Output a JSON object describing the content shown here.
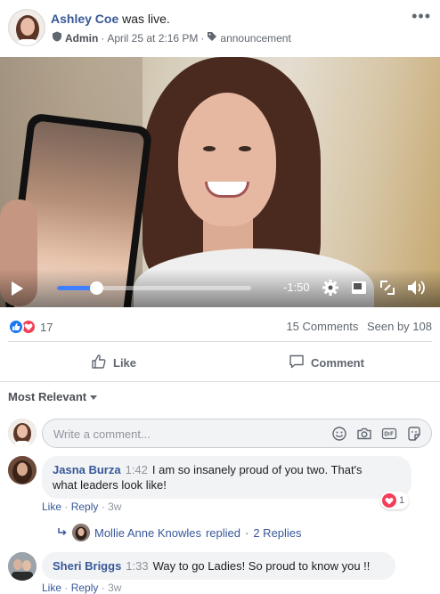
{
  "post": {
    "author": "Ashley Coe",
    "verb": "was live.",
    "role": "Admin",
    "date": "April 25 at 2:16 PM",
    "separator": "·",
    "tag": "announcement",
    "more": "•••"
  },
  "video": {
    "time_remaining": "-1:50",
    "progress": 0.2
  },
  "stats": {
    "reaction_count": "17",
    "comments": "15 Comments",
    "seen": "Seen by 108"
  },
  "actions": {
    "like_label": "Like",
    "comment_label": "Comment"
  },
  "sort": {
    "label": "Most Relevant"
  },
  "composer": {
    "placeholder": "Write a comment..."
  },
  "comments": [
    {
      "name": "Jasna Burza",
      "time": "1:42",
      "text": "I am so insanely proud of you two. That's",
      "text2": "what leaders look like!",
      "like": "Like",
      "reply": "Reply",
      "age": "3w",
      "reaction_count": "1",
      "replies": {
        "name": "Mollie Anne Knowles",
        "action": "replied",
        "count": "2 Replies"
      }
    },
    {
      "name": "Sheri Briggs",
      "time": "1:33",
      "text": "Way to go Ladies! So proud to know you !!",
      "like": "Like",
      "reply": "Reply",
      "age": "3w"
    }
  ],
  "colors": {
    "link": "#385898",
    "like_blue": "#1877f2",
    "love_red": "#f33e58",
    "progress_blue": "#4080ff"
  }
}
